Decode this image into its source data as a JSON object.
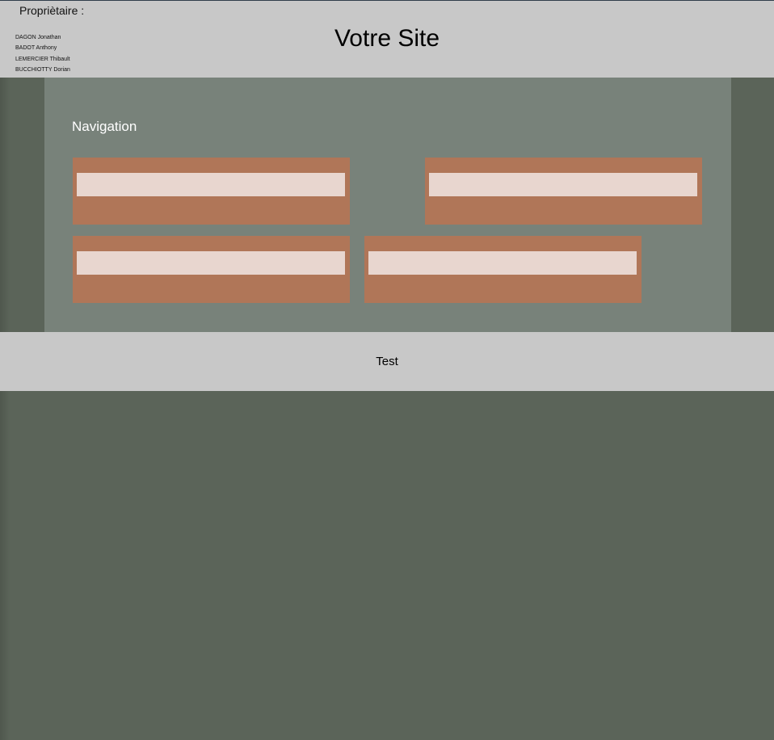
{
  "header": {
    "owner_heading": "Propriètaire :",
    "owners": [
      "DAGON Jonathan",
      "BADOT Anthony",
      "LEMERCIER Thibault",
      "BUCCHIOTTY Dorian"
    ],
    "site_title": "Votre Site"
  },
  "navigation": {
    "title": "Navigation",
    "items": [
      {
        "label": ""
      },
      {
        "label": ""
      },
      {
        "label": ""
      },
      {
        "label": ""
      }
    ]
  },
  "footer": {
    "text": "Test"
  },
  "colors": {
    "header_bg": "#c8c8c8",
    "page_bg": "#5b6459",
    "nav_bg": "#78827a",
    "card_bg": "#b07658",
    "card_bar": "#e8d6cf"
  }
}
